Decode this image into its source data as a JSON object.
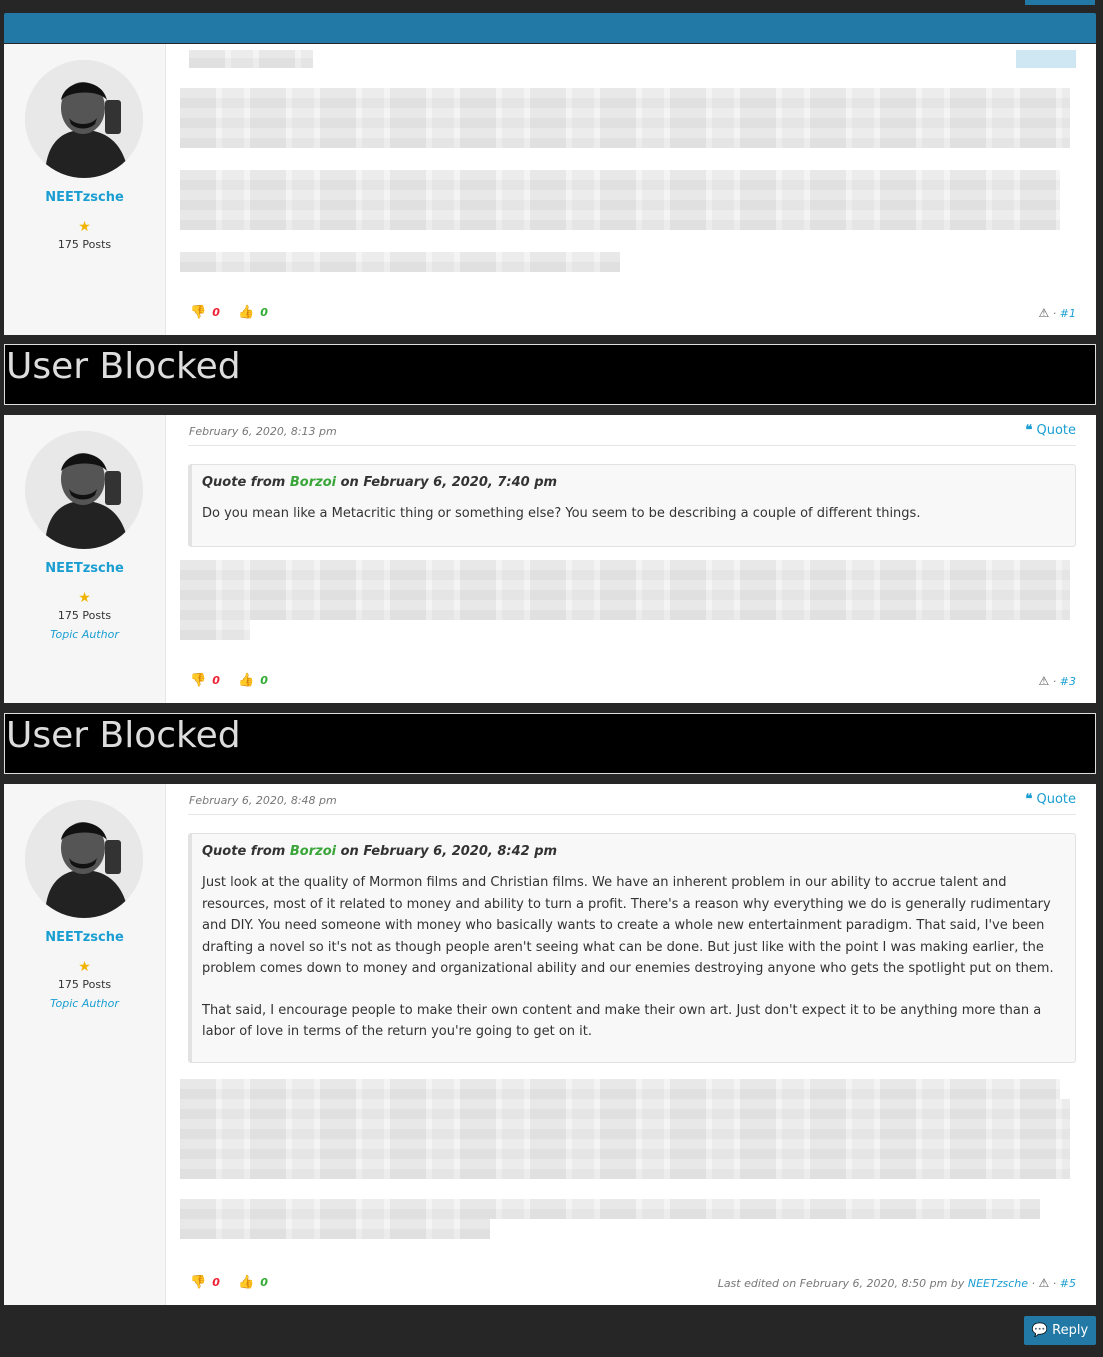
{
  "colors": {
    "accent": "#2279a5",
    "link": "#1a9ed2",
    "downvote": "#e23333",
    "upvote": "#33aa33"
  },
  "posts": [
    {
      "username": "NEETzsche",
      "post_count": "175 Posts",
      "role": "",
      "date": "",
      "quote_label": "",
      "downvotes": "0",
      "upvotes": "0",
      "post_number": "#1",
      "edited": ""
    },
    {
      "username": "NEETzsche",
      "post_count": "175 Posts",
      "role": "Topic Author",
      "date": "February 6, 2020, 8:13 pm",
      "quote_label": "Quote",
      "quote": {
        "prefix": "Quote from",
        "author": "Borzoi",
        "on": "on February 6, 2020, 7:40 pm",
        "paragraphs": [
          "Do you mean like a Metacritic thing or something else? You seem to be describing a couple of different things."
        ]
      },
      "downvotes": "0",
      "upvotes": "0",
      "post_number": "#3",
      "edited": ""
    },
    {
      "username": "NEETzsche",
      "post_count": "175 Posts",
      "role": "Topic Author",
      "date": "February 6, 2020, 8:48 pm",
      "quote_label": "Quote",
      "quote": {
        "prefix": "Quote from",
        "author": "Borzoi",
        "on": "on February 6, 2020, 8:42 pm",
        "paragraphs": [
          "Just look at the quality of Mormon films and Christian films. We have an inherent problem in our ability to accrue talent and resources, most of it related to money and ability to turn a profit. There's a reason why everything we do is generally rudimentary and DIY. You need someone with money who basically wants to create a whole new entertainment paradigm. That said, I've been drafting a novel so it's not as though people aren't seeing what can be done. But just like with the point I was making earlier, the problem comes down to money and organizational ability and our enemies destroying anyone who gets the spotlight put on them.",
          "That said, I encourage people to make their own content and make their own art. Just don't expect it to be anything more than a labor of love in terms of the return you're going to get on it."
        ]
      },
      "downvotes": "0",
      "upvotes": "0",
      "post_number": "#5",
      "edited_prefix": "Last edited on February 6, 2020, 8:50 pm by",
      "edited_by": "NEETzsche"
    }
  ],
  "blocked_label": "User Blocked",
  "reply_label": "Reply",
  "icons": [
    "thumbs-down-icon",
    "thumbs-up-icon",
    "warning-icon",
    "quote-icon",
    "star-icon",
    "reply-icon"
  ]
}
